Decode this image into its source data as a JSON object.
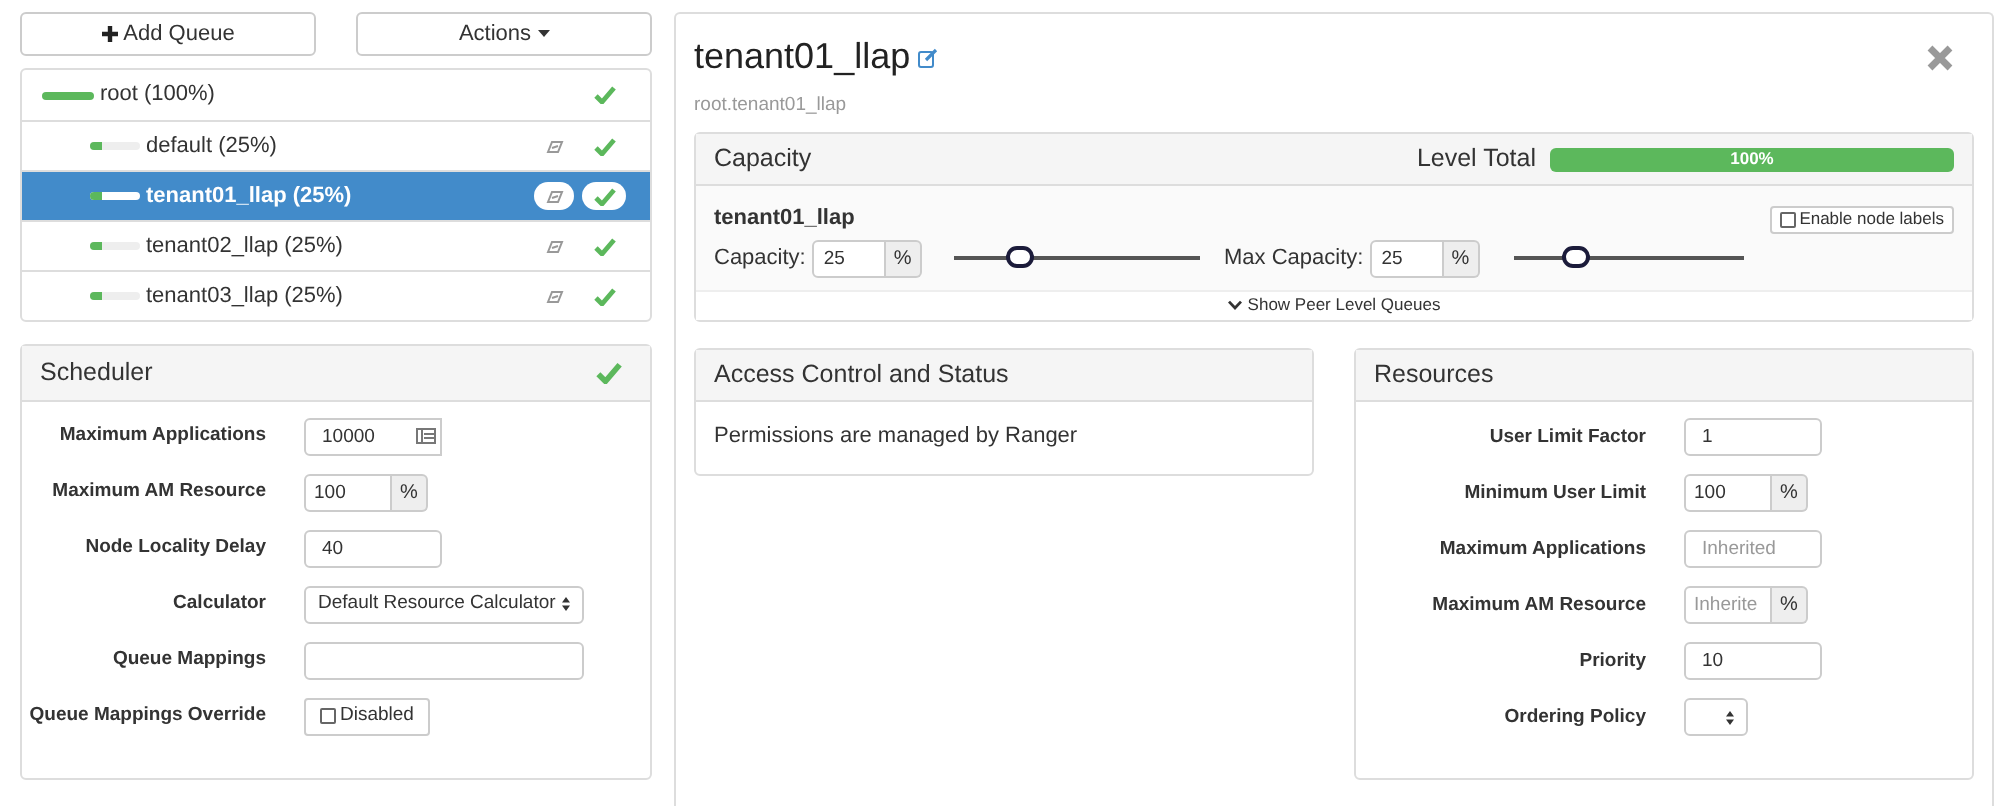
{
  "toolbar": {
    "add_queue": "Add Queue",
    "actions": "Actions"
  },
  "queues": [
    {
      "label": "root (100%)",
      "level": 1,
      "selected": false,
      "children": [
        {
          "label": "default (25%)",
          "level": 0.25,
          "selected": false,
          "labels_icon": true
        },
        {
          "label": "tenant01_llap (25%)",
          "level": 0.25,
          "selected": true,
          "labels_icon": true
        },
        {
          "label": "tenant02_llap (25%)",
          "level": 0.25,
          "selected": false,
          "labels_icon": true
        },
        {
          "label": "tenant03_llap (25%)",
          "level": 0.25,
          "selected": false,
          "labels_icon": true
        }
      ]
    }
  ],
  "scheduler": {
    "title": "Scheduler",
    "fields": [
      {
        "kind": "calendar",
        "label": "Maximum Applications",
        "value": "10000"
      },
      {
        "kind": "addon",
        "label": "Maximum AM Resource",
        "value": "100",
        "unit": "%"
      },
      {
        "kind": "input",
        "label": "Node Locality Delay",
        "value": "40"
      },
      {
        "kind": "select",
        "label": "Calculator",
        "value": "Default Resource Calculator"
      },
      {
        "kind": "wide",
        "label": "Queue Mappings"
      },
      {
        "kind": "checkbox",
        "label": "Queue Mappings Override",
        "text": "Disabled",
        "checked": false
      }
    ]
  },
  "detail": {
    "title": "tenant01_llap",
    "path": "root.tenant01_llap",
    "capacity": {
      "title": "Capacity",
      "level_total_label": "Level Total",
      "level_total": {
        "text": "100%",
        "level": 1
      },
      "queue_name": "tenant01_llap",
      "node_labels": {
        "text": "Enable node labels",
        "checked": false
      },
      "sliders": [
        {
          "label": "Capacity:",
          "value": "25",
          "unit": "%",
          "level": 0.27
        },
        {
          "label": "Max Capacity:",
          "value": "25",
          "unit": "%",
          "level": 0.27
        }
      ],
      "show_peer": "Show Peer Level Queues"
    },
    "access": {
      "title": "Access Control and Status",
      "text": "Permissions are managed by Ranger"
    },
    "resources": {
      "title": "Resources",
      "fields": [
        {
          "kind": "input",
          "label": "User Limit Factor",
          "value": "1"
        },
        {
          "kind": "addon",
          "label": "Minimum User Limit",
          "value": "100",
          "unit": "%"
        },
        {
          "kind": "input",
          "label": "Maximum Applications",
          "placeholder": "Inherited"
        },
        {
          "kind": "addon",
          "label": "Maximum AM Resource",
          "placeholder": "Inherite",
          "unit": "%"
        },
        {
          "kind": "input",
          "label": "Priority",
          "value": "10"
        },
        {
          "kind": "select",
          "label": "Ordering Policy"
        }
      ]
    }
  }
}
